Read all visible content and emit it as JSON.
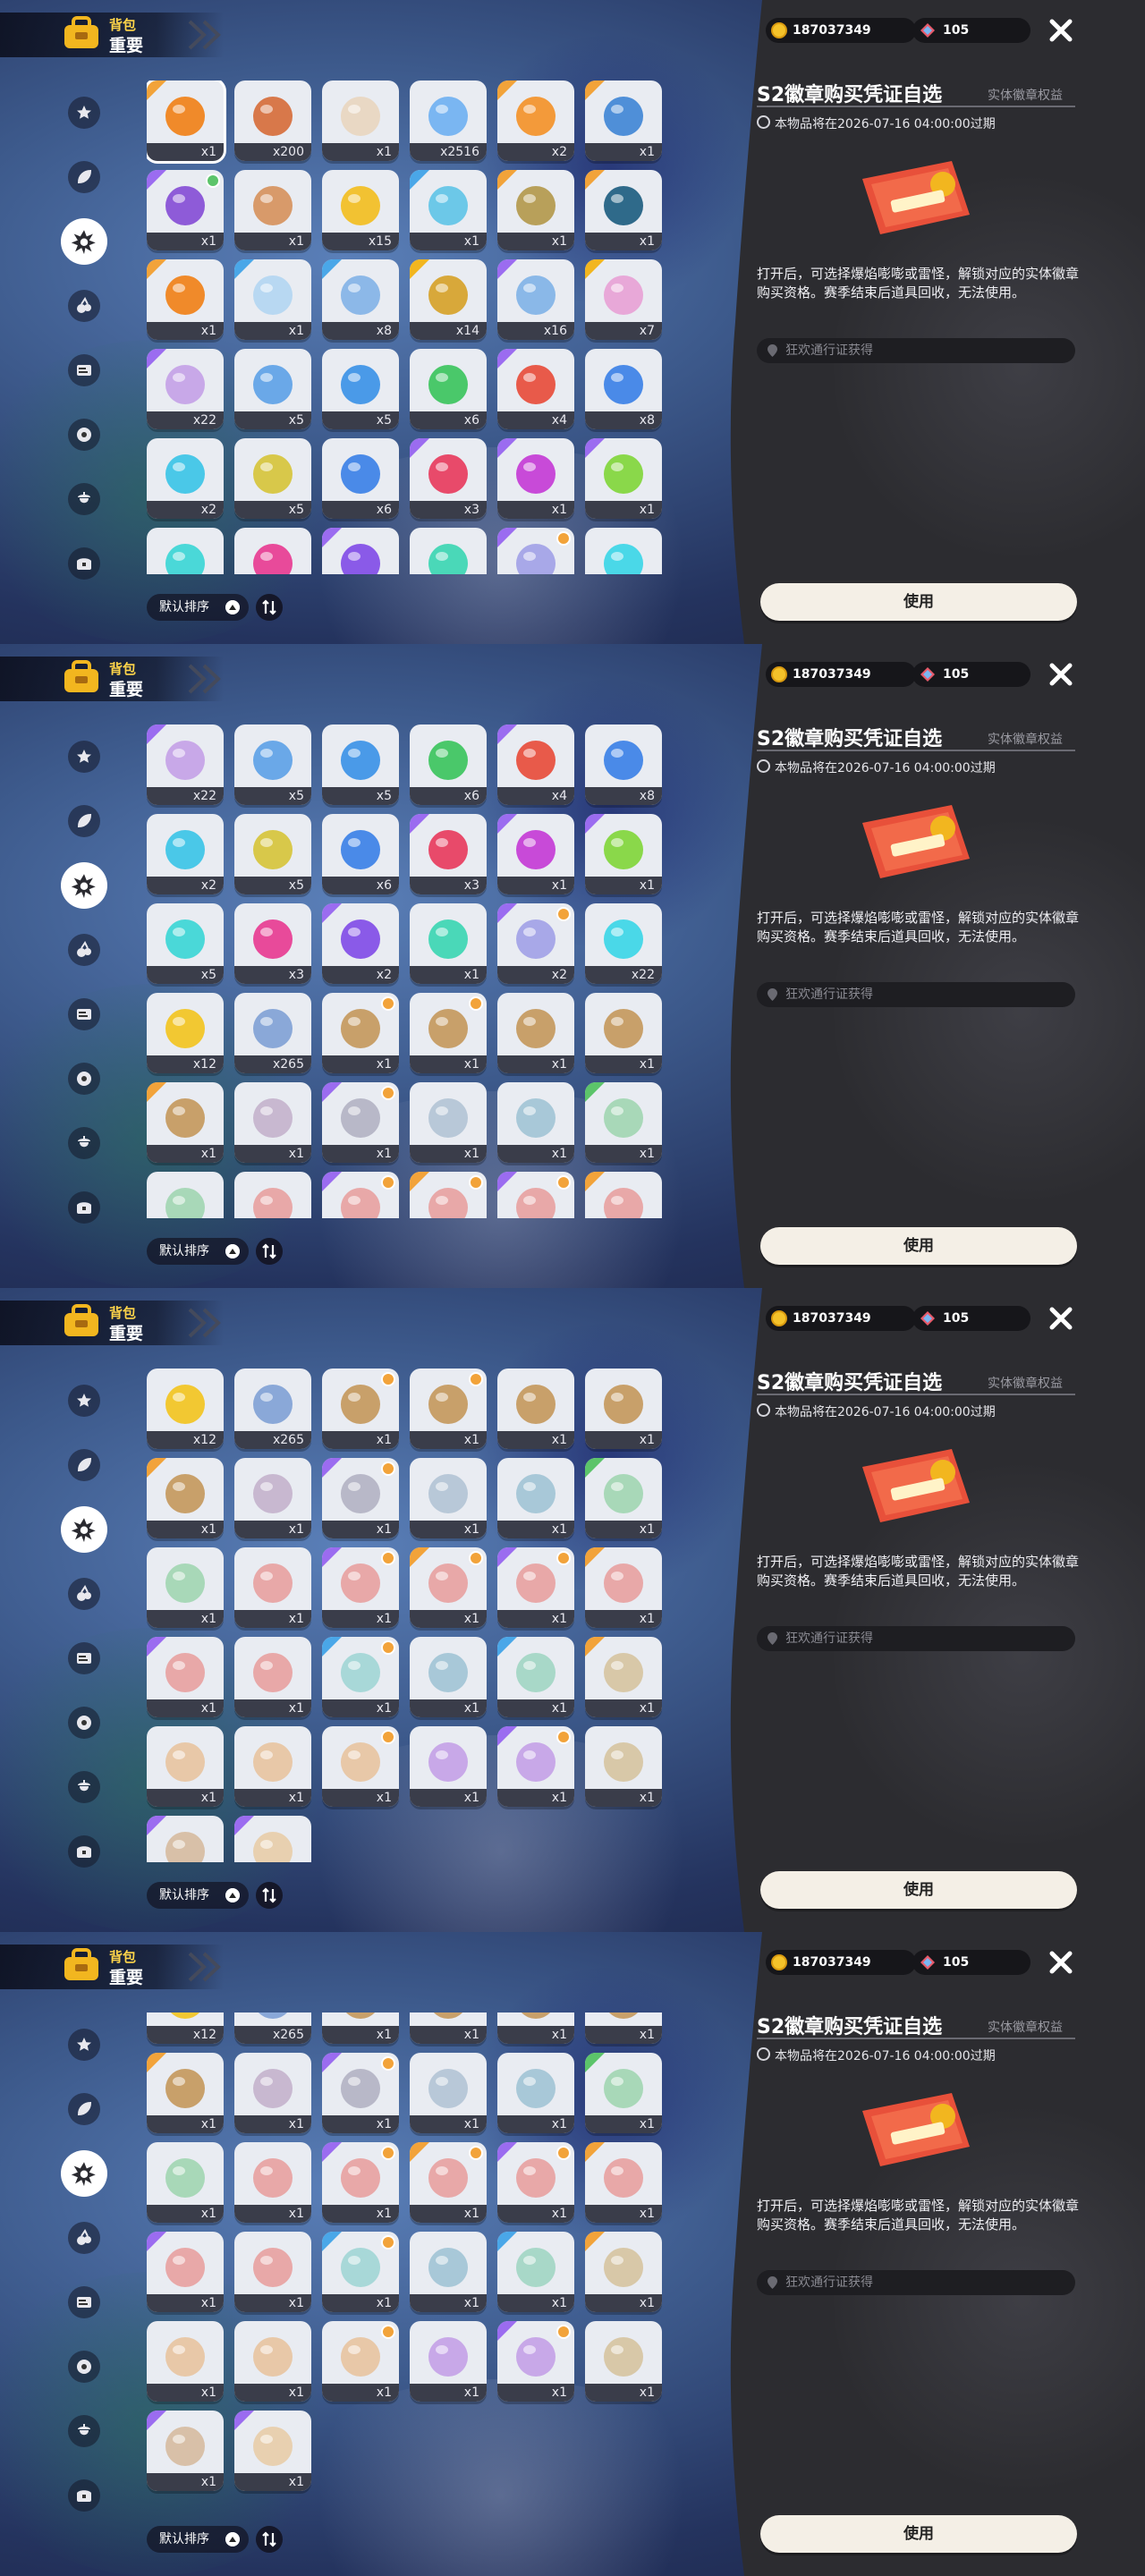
{
  "header": {
    "subtitle": "背包",
    "title": "重要"
  },
  "currency": {
    "coins": "187037349",
    "gems": "105"
  },
  "sidebar": {
    "items": [
      {
        "name": "sidebar-item-star",
        "icon": "star-badge-icon"
      },
      {
        "name": "sidebar-item-leaf",
        "icon": "leaf-icon"
      },
      {
        "name": "sidebar-item-badge",
        "icon": "splat-badge-icon",
        "active": true
      },
      {
        "name": "sidebar-item-cherry",
        "icon": "cherry-icon"
      },
      {
        "name": "sidebar-item-card",
        "icon": "card-icon"
      },
      {
        "name": "sidebar-item-ball",
        "icon": "ball-icon"
      },
      {
        "name": "sidebar-item-acorn",
        "icon": "acorn-icon"
      },
      {
        "name": "sidebar-item-chest",
        "icon": "chest-icon"
      }
    ]
  },
  "detail": {
    "title": "S2徽章购买凭证自选",
    "type": "实体徽章权益",
    "expire": "本物品将在2026-07-16 04:00:00过期",
    "description": "打开后，可选择爆焰嘭嘭或雷怪，解锁对应的实体徽章购买资格。赛季结束后道具回收，无法使用。",
    "source": "狂欢通行证获得",
    "use_label": "使用"
  },
  "sort": {
    "label": "默认排序"
  },
  "grid": {
    "colors": {
      "orange": "#f2a33a",
      "purple": "#9b6cf0",
      "blue": "#4aa7e8",
      "gold": "#f2b61f",
      "green": "#5cc46a"
    },
    "items": [
      {
        "count": "x1",
        "rarity": "orange",
        "art": "#f08a2a",
        "badge": "",
        "selected": true
      },
      {
        "count": "x200",
        "rarity": "",
        "art": "#d8784a",
        "badge": ""
      },
      {
        "count": "x1",
        "rarity": "",
        "art": "#e9d8c4",
        "badge": ""
      },
      {
        "count": "x2516",
        "rarity": "",
        "art": "#7ab6f2",
        "badge": ""
      },
      {
        "count": "x2",
        "rarity": "orange",
        "art": "#f39a3a",
        "badge": ""
      },
      {
        "count": "x1",
        "rarity": "orange",
        "art": "#4f8fd8",
        "badge": ""
      },
      {
        "count": "x1",
        "rarity": "purple",
        "art": "#8e5bd8",
        "badge": "#5cc46a"
      },
      {
        "count": "x1",
        "rarity": "",
        "art": "#d89a6a",
        "badge": ""
      },
      {
        "count": "x15",
        "rarity": "",
        "art": "#f2c232",
        "badge": ""
      },
      {
        "count": "x1",
        "rarity": "blue",
        "art": "#6cc8e8",
        "badge": ""
      },
      {
        "count": "x1",
        "rarity": "orange",
        "art": "#b8a05a",
        "badge": ""
      },
      {
        "count": "x1",
        "rarity": "orange",
        "art": "#2f6a8a",
        "badge": ""
      },
      {
        "count": "x1",
        "rarity": "orange",
        "art": "#f08a2a",
        "badge": ""
      },
      {
        "count": "x1",
        "rarity": "blue",
        "art": "#b8d8f2",
        "badge": ""
      },
      {
        "count": "x8",
        "rarity": "blue",
        "art": "#8cb8e8",
        "badge": ""
      },
      {
        "count": "x14",
        "rarity": "gold",
        "art": "#d8a83a",
        "badge": ""
      },
      {
        "count": "x16",
        "rarity": "purple",
        "art": "#8ab8e8",
        "badge": ""
      },
      {
        "count": "x7",
        "rarity": "gold",
        "art": "#e8a8d8",
        "badge": ""
      },
      {
        "count": "x22",
        "rarity": "purple",
        "art": "#c8a8e8",
        "badge": ""
      },
      {
        "count": "x5",
        "rarity": "",
        "art": "#6aa8e8",
        "badge": ""
      },
      {
        "count": "x5",
        "rarity": "",
        "art": "#4a9ae8",
        "badge": ""
      },
      {
        "count": "x6",
        "rarity": "",
        "art": "#4ac86a",
        "badge": ""
      },
      {
        "count": "x4",
        "rarity": "purple",
        "art": "#e85a4a",
        "badge": ""
      },
      {
        "count": "x8",
        "rarity": "",
        "art": "#4a8ae8",
        "badge": ""
      },
      {
        "count": "x2",
        "rarity": "",
        "art": "#4ac8e8",
        "badge": ""
      },
      {
        "count": "x5",
        "rarity": "",
        "art": "#d8c84a",
        "badge": ""
      },
      {
        "count": "x6",
        "rarity": "",
        "art": "#4a8ae8",
        "badge": ""
      },
      {
        "count": "x3",
        "rarity": "purple",
        "art": "#e84a6a",
        "badge": ""
      },
      {
        "count": "x1",
        "rarity": "purple",
        "art": "#c84ad8",
        "badge": ""
      },
      {
        "count": "x1",
        "rarity": "purple",
        "art": "#8ad84a",
        "badge": ""
      },
      {
        "count": "x5",
        "rarity": "",
        "art": "#4ad8d8",
        "badge": ""
      },
      {
        "count": "x3",
        "rarity": "",
        "art": "#e84a9a",
        "badge": ""
      },
      {
        "count": "x2",
        "rarity": "purple",
        "art": "#8a5ae8",
        "badge": ""
      },
      {
        "count": "x1",
        "rarity": "",
        "art": "#4ad8b8",
        "badge": ""
      },
      {
        "count": "x2",
        "rarity": "purple",
        "art": "#a8a8e8",
        "badge": "#f2a33a"
      },
      {
        "count": "x22",
        "rarity": "",
        "art": "#4ad8e8",
        "badge": ""
      },
      {
        "count": "x12",
        "rarity": "",
        "art": "#f2c832",
        "badge": ""
      },
      {
        "count": "x265",
        "rarity": "",
        "art": "#8aa8d8",
        "badge": ""
      },
      {
        "count": "x1",
        "rarity": "",
        "art": "#c8a06a",
        "badge": "#f2a33a"
      },
      {
        "count": "x1",
        "rarity": "",
        "art": "#c8a06a",
        "badge": "#f2a33a"
      },
      {
        "count": "x1",
        "rarity": "",
        "art": "#c8a06a",
        "badge": ""
      },
      {
        "count": "x1",
        "rarity": "",
        "art": "#c8a06a",
        "badge": ""
      },
      {
        "count": "x1",
        "rarity": "orange",
        "art": "#c8a06a",
        "badge": ""
      },
      {
        "count": "x1",
        "rarity": "",
        "art": "#c8b8d0",
        "badge": ""
      },
      {
        "count": "x1",
        "rarity": "purple",
        "art": "#b8b8c8",
        "badge": "#f2a33a"
      },
      {
        "count": "x1",
        "rarity": "",
        "art": "#b8c8d8",
        "badge": ""
      },
      {
        "count": "x1",
        "rarity": "",
        "art": "#a8c8d8",
        "badge": ""
      },
      {
        "count": "x1",
        "rarity": "green",
        "art": "#a8d8b8",
        "badge": ""
      },
      {
        "count": "x1",
        "rarity": "",
        "art": "#a8d8b8",
        "badge": ""
      },
      {
        "count": "x1",
        "rarity": "",
        "art": "#e8a8a8",
        "badge": ""
      },
      {
        "count": "x1",
        "rarity": "purple",
        "art": "#e8a8a8",
        "badge": "#f2a33a"
      },
      {
        "count": "x1",
        "rarity": "orange",
        "art": "#e8a8a8",
        "badge": "#f2a33a"
      },
      {
        "count": "x1",
        "rarity": "purple",
        "art": "#e8a8a8",
        "badge": "#f2a33a"
      },
      {
        "count": "x1",
        "rarity": "orange",
        "art": "#e8a8a8",
        "badge": ""
      },
      {
        "count": "x1",
        "rarity": "purple",
        "art": "#e8a8a8",
        "badge": ""
      },
      {
        "count": "x1",
        "rarity": "",
        "art": "#e8a8a8",
        "badge": ""
      },
      {
        "count": "x1",
        "rarity": "blue",
        "art": "#a8d8d8",
        "badge": "#f2a33a"
      },
      {
        "count": "x1",
        "rarity": "",
        "art": "#a8c8d8",
        "badge": ""
      },
      {
        "count": "x1",
        "rarity": "blue",
        "art": "#a8d8c8",
        "badge": ""
      },
      {
        "count": "x1",
        "rarity": "orange",
        "art": "#d8c8a8",
        "badge": ""
      },
      {
        "count": "x1",
        "rarity": "",
        "art": "#e8c8a8",
        "badge": ""
      },
      {
        "count": "x1",
        "rarity": "",
        "art": "#e8c8a8",
        "badge": ""
      },
      {
        "count": "x1",
        "rarity": "",
        "art": "#e8c8a8",
        "badge": "#f2a33a"
      },
      {
        "count": "x1",
        "rarity": "",
        "art": "#c8a8e8",
        "badge": ""
      },
      {
        "count": "x1",
        "rarity": "purple",
        "art": "#c8a8e8",
        "badge": "#f2a33a"
      },
      {
        "count": "x1",
        "rarity": "",
        "art": "#d8c8a8",
        "badge": ""
      },
      {
        "count": "x1",
        "rarity": "purple",
        "art": "#d8c0a8",
        "badge": ""
      },
      {
        "count": "x1",
        "rarity": "purple",
        "art": "#e8d0b0",
        "badge": ""
      }
    ]
  },
  "panels": [
    {
      "first_row": 0,
      "offset_rows": 0
    },
    {
      "first_row": 3,
      "offset_rows": 0
    },
    {
      "first_row": 6,
      "offset_rows": 0
    },
    {
      "first_row": 6,
      "offset_rows": 0.55
    }
  ]
}
